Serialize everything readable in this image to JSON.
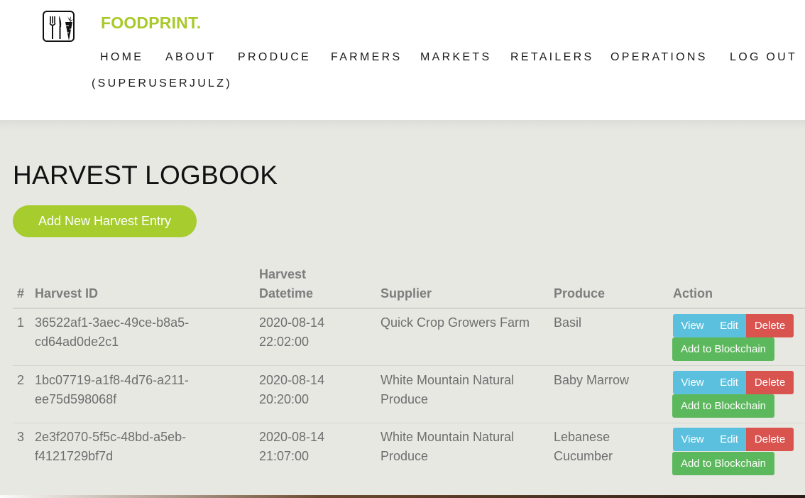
{
  "brand": {
    "name": "FOODPRINT."
  },
  "nav": {
    "items": [
      {
        "label": "HOME"
      },
      {
        "label": "ABOUT"
      },
      {
        "label": "PRODUCE"
      },
      {
        "label": "FARMERS"
      },
      {
        "label": "MARKETS"
      },
      {
        "label": "RETAILERS"
      },
      {
        "label": "OPERATIONS"
      },
      {
        "label": "LOG OUT"
      }
    ],
    "user": "(SUPERUSERJULZ)"
  },
  "page": {
    "title": "HARVEST LOGBOOK",
    "add_button": "Add New Harvest Entry"
  },
  "table": {
    "columns": [
      "#",
      "Harvest ID",
      "Harvest",
      "Datetime",
      "Supplier",
      "Produce",
      "Action"
    ],
    "rows": [
      {
        "num": "1",
        "id_line1": "36522af1-3aec-49ce-b8a5-",
        "id_line2": "cd64ad0de2c1",
        "date": "2020-08-14",
        "time": "22:02:00",
        "supplier_line1": "Quick Crop Growers Farm",
        "supplier_line2": "",
        "produce_line1": "Basil",
        "produce_line2": ""
      },
      {
        "num": "2",
        "id_line1": "1bc07719-a1f8-4d76-a211-",
        "id_line2": "ee75d598068f",
        "date": "2020-08-14",
        "time": "20:20:00",
        "supplier_line1": "White Mountain Natural",
        "supplier_line2": "Produce",
        "produce_line1": "Baby Marrow",
        "produce_line2": ""
      },
      {
        "num": "3",
        "id_line1": "2e3f2070-5f5c-48bd-a5eb-",
        "id_line2": "f4121729bf7d",
        "date": "2020-08-14",
        "time": "21:07:00",
        "supplier_line1": "White Mountain Natural",
        "supplier_line2": "Produce",
        "produce_line1": "Lebanese",
        "produce_line2": "Cucumber"
      }
    ],
    "actions": {
      "view": "View",
      "edit": "Edit",
      "delete": "Delete",
      "chain": "Add to Blockchain"
    }
  },
  "colors": {
    "brand_green": "#a8c92a",
    "add_button": "#a6cc2e",
    "info": "#5bc0de",
    "danger": "#d9534f",
    "success": "#5cb85c",
    "main_bg": "#e8e8e3"
  },
  "icons": {
    "logo": "fork-carrot-logo-icon"
  }
}
